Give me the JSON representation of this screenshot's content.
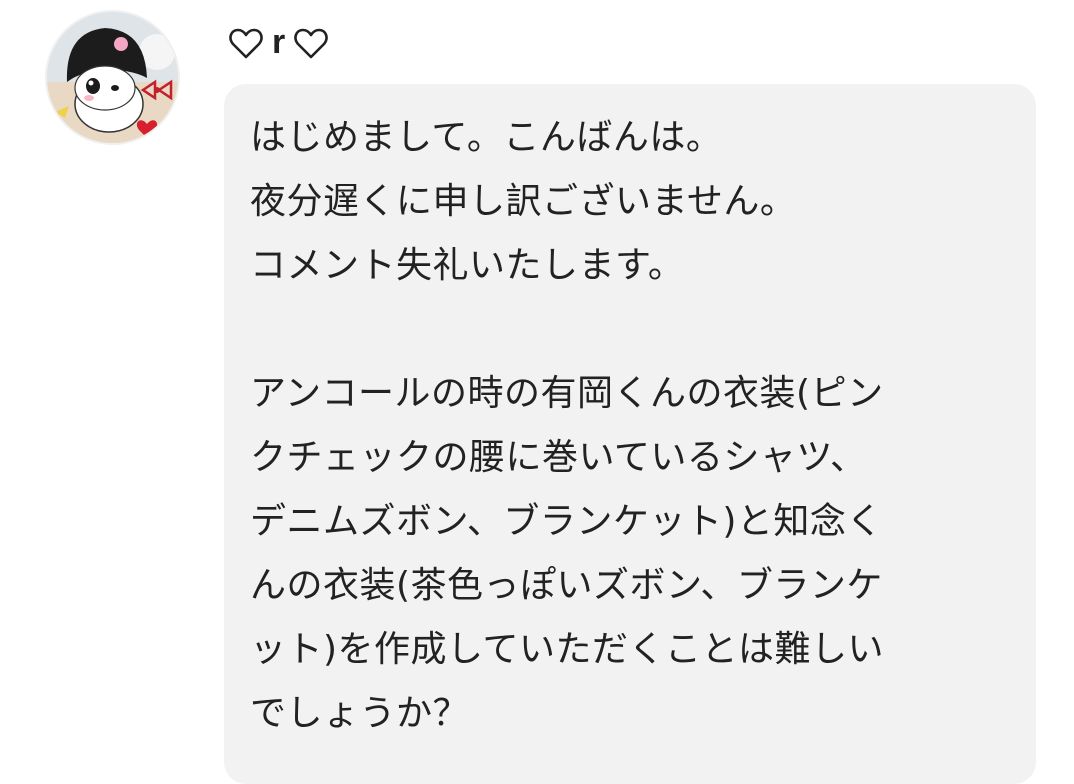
{
  "comment": {
    "author": {
      "heart_left_icon": "heart-outline-icon",
      "name": "r",
      "heart_right_icon": "heart-outline-icon",
      "avatar": "avatar-image"
    },
    "message_lines": [
      "はじめまして。こんばんは。",
      "夜分遅くに申し訳ございません。",
      "コメント失礼いたします。",
      "",
      "アンコールの時の有岡くんの衣装(ピン",
      "クチェックの腰に巻いているシャツ、",
      "デニムズボン、ブランケット)と知念く",
      "んの衣装(茶色っぽいズボン、ブランケ",
      "ット)を作成していただくことは難しい",
      "でしょうか？"
    ],
    "bubble_color": "#f2f2f2",
    "text_color": "#222222"
  }
}
